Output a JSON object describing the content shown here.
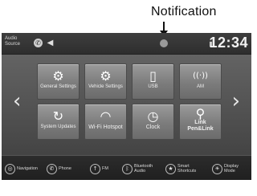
{
  "callout": {
    "label": "Notification"
  },
  "status_bar": {
    "audio_source": "Audio Source",
    "clock": "12:34"
  },
  "tiles": [
    {
      "label": "General Settings",
      "icon": "gear-icon",
      "glyph": "⚙"
    },
    {
      "label": "Vehicle Settings",
      "icon": "car-gear-icon",
      "glyph": "⚙"
    },
    {
      "label": "USB",
      "icon": "usb-icon",
      "glyph": "▯"
    },
    {
      "label": "AM",
      "icon": "radio-wave-icon",
      "glyph": "((·))"
    },
    {
      "label": "System Updates",
      "icon": "refresh-icon",
      "glyph": "↻"
    },
    {
      "label": "Wi-Fi Hotspot",
      "icon": "wifi-icon",
      "glyph": "◠"
    },
    {
      "label": "Clock",
      "icon": "clock-icon",
      "glyph": "◷"
    },
    {
      "label": "Link Pen&Link",
      "icon": "link-icon",
      "glyph": "⚲"
    }
  ],
  "bottom_bar": [
    {
      "label": "Navigation",
      "icon": "navigation-icon",
      "glyph": "◎"
    },
    {
      "label": "Phone",
      "icon": "phone-icon",
      "glyph": "✆"
    },
    {
      "label": "FM",
      "icon": "fm-icon",
      "glyph": "↑"
    },
    {
      "label": "Bluetooth Audio",
      "icon": "bluetooth-icon",
      "glyph": "ᛒ"
    },
    {
      "label": "Smart Shortcuts",
      "icon": "shortcut-icon",
      "glyph": "★"
    },
    {
      "label": "Display Mode",
      "icon": "display-icon",
      "glyph": "☀"
    }
  ],
  "page_indicator": {
    "current": 1,
    "total": 2
  }
}
